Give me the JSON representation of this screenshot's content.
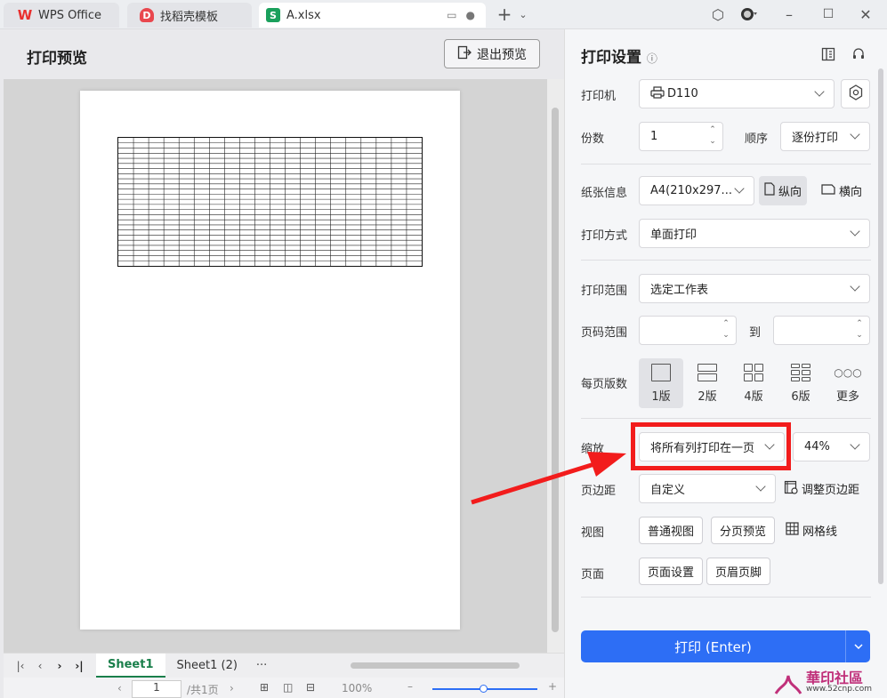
{
  "tabs": [
    {
      "label": "WPS Office"
    },
    {
      "label": "找稻壳模板"
    },
    {
      "label": "A.xlsx"
    }
  ],
  "preview": {
    "title": "打印预览",
    "exit_label": "退出预览"
  },
  "sheets": {
    "active": "Sheet1",
    "other": "Sheet1 (2)",
    "more": "···"
  },
  "statusbar": {
    "page_value": "1",
    "page_total": "/共1页",
    "zoom": "100%"
  },
  "settings": {
    "title": "打印设置",
    "printer_label": "打印机",
    "printer_value": "D110",
    "copies_label": "份数",
    "copies_value": "1",
    "order_label": "顺序",
    "order_value": "逐份打印",
    "paper_label": "纸张信息",
    "paper_value": "A4(210x297...",
    "portrait_label": "纵向",
    "landscape_label": "横向",
    "method_label": "打印方式",
    "method_value": "单面打印",
    "range_label": "打印范围",
    "range_value": "选定工作表",
    "pages_label": "页码范围",
    "pages_to": "到",
    "per_page_label": "每页版数",
    "layouts": [
      "1版",
      "2版",
      "4版",
      "6版",
      "更多"
    ],
    "zoom_label": "缩放",
    "zoom_mode": "将所有列打印在一页",
    "zoom_percent": "44%",
    "margin_label": "页边距",
    "margin_value": "自定义",
    "adjust_margin_label": "调整页边距",
    "view_label": "视图",
    "normal_view": "普通视图",
    "page_break_view": "分页预览",
    "gridlines_label": "网格线",
    "page_label": "页面",
    "page_setup": "页面设置",
    "header_footer": "页眉页脚",
    "print_button": "打印 (Enter)"
  },
  "watermark": {
    "text": "華印社區",
    "url": "www.52cnp.com"
  },
  "colors": {
    "accent": "#2d6ef5",
    "sheet_green": "#1a7f4b",
    "highlight_red": "#f21c1c"
  }
}
